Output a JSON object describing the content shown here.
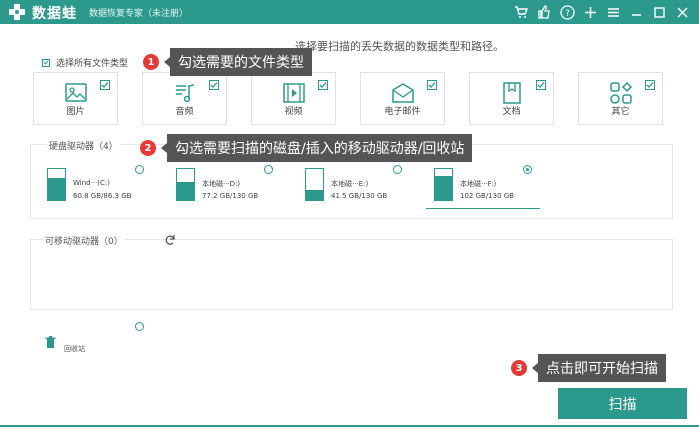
{
  "app": {
    "title": "数据蛙",
    "subtitle": "数据恢复专家（未注册）"
  },
  "titlebar": {
    "icons": [
      "cart-icon",
      "thumbs-up-icon",
      "help-icon",
      "plus-icon",
      "menu-icon",
      "minimize-icon",
      "close-icon"
    ]
  },
  "instruction": "选择要扫描的丢失数据的数据类型和路径。",
  "select_all": {
    "label": "选择所有文件类型",
    "checked": true
  },
  "file_types": [
    {
      "label": "图片",
      "icon": "image-icon",
      "checked": true
    },
    {
      "label": "音频",
      "icon": "audio-icon",
      "checked": true
    },
    {
      "label": "视频",
      "icon": "video-icon",
      "checked": true
    },
    {
      "label": "电子邮件",
      "icon": "email-icon",
      "checked": true
    },
    {
      "label": "文档",
      "icon": "document-icon",
      "checked": true
    },
    {
      "label": "其它",
      "icon": "other-icon",
      "checked": true
    }
  ],
  "hard_drives": {
    "title": "硬盘驱动器（4）",
    "drives": [
      {
        "name": "Wind···(C:)",
        "size": "60.8 GB/86.3 GB",
        "fill": 0.7,
        "selected": false,
        "windows": true
      },
      {
        "name": "本地磁···D:)",
        "size": "77.2 GB/130 GB",
        "fill": 0.59,
        "selected": false
      },
      {
        "name": "本地磁···E:)",
        "size": "41.5 GB/130 GB",
        "fill": 0.32,
        "selected": false
      },
      {
        "name": "本地磁···F:)",
        "size": "102 GB/130 GB",
        "fill": 0.78,
        "selected": true
      }
    ]
  },
  "removable": {
    "title": "可移动驱动器（0）",
    "refresh_icon": "refresh-icon"
  },
  "recycle_bin": {
    "label": "回收站",
    "icon": "trash-icon"
  },
  "callouts": [
    {
      "num": "1",
      "text": "勾选需要的文件类型"
    },
    {
      "num": "2",
      "text": "勾选需要扫描的磁盘/插入的移动驱动器/回收站"
    },
    {
      "num": "3",
      "text": "点击即可开始扫描"
    }
  ],
  "scan_button": "扫描",
  "colors": {
    "accent": "#2b9a8c",
    "callout_bg": "#555555",
    "badge": "#e53935"
  }
}
